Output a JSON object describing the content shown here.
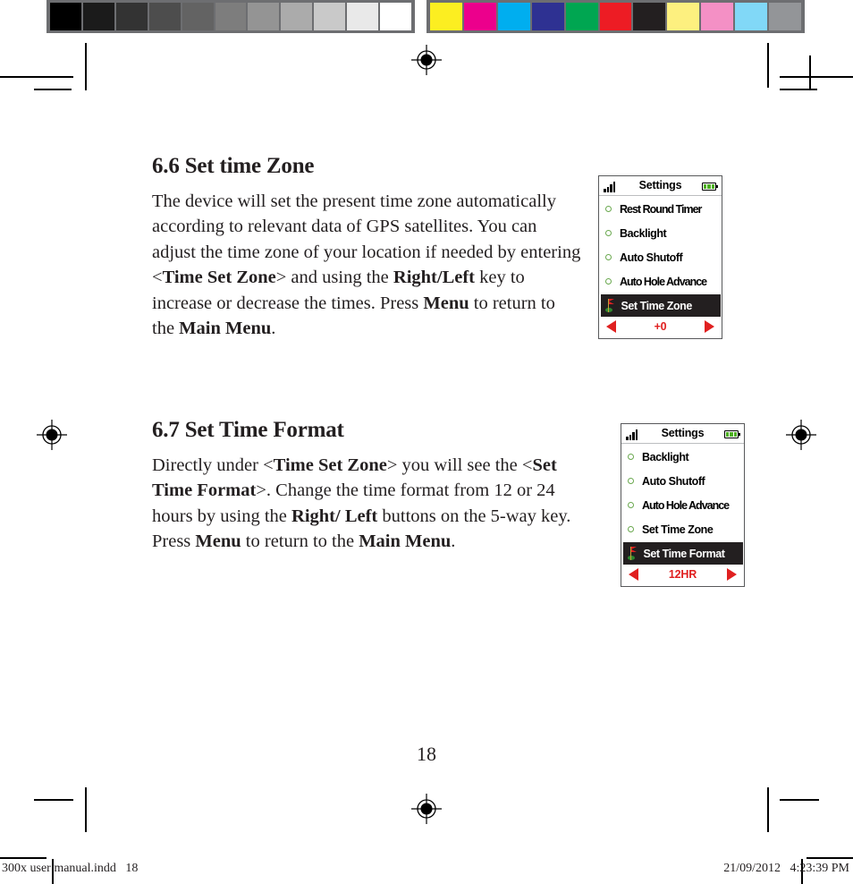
{
  "print_marks": {
    "gray_swatches": [
      "#000000",
      "#1b1b1b",
      "#333333",
      "#4d4d4d",
      "#636363",
      "#7d7d7d",
      "#949494",
      "#ababab",
      "#c9c9c9",
      "#e9e9e9",
      "#ffffff"
    ],
    "color_swatches": [
      "#fcee21",
      "#ec008c",
      "#00aeef",
      "#2e3192",
      "#00a651",
      "#ed1c24",
      "#231f20",
      "#fdf07f",
      "#f490c5",
      "#81d8f7",
      "#939598"
    ],
    "bar_background": "#6d6e71",
    "registration_mark_name": "registration-target"
  },
  "sections": [
    {
      "heading": "6.6 Set time Zone",
      "body_html": "The device will set the present time zone automatically according to relevant data of GPS satellites. You can adjust the time zone of your location if needed by entering &lt;<b>Time Set Zone</b>&gt; and using the <b>Right/Left</b> key to increase or decrease the times. Press <b>Menu</b> to return to the <b>Main Menu</b>."
    },
    {
      "heading": "6.7 Set Time Format",
      "body_html": "Directly under &lt;<b>Time Set Zone</b>&gt; you will see the &lt;<b>Set Time Format</b>&gt;. Change the time format from 12 or 24 hours by using the <b>Right/ Left</b> buttons on the 5-way key. Press <b>Menu</b> to return to the <b>Main Menu</b>."
    }
  ],
  "devices": [
    {
      "title": "Settings",
      "signal_icon": "signal-bars-icon",
      "battery_icon": "battery-full-icon",
      "items": [
        {
          "label": "Rest Round Timer",
          "selected": false,
          "compact": true
        },
        {
          "label": "Backlight",
          "selected": false,
          "compact": false
        },
        {
          "label": "Auto Shutoff",
          "selected": false,
          "compact": false
        },
        {
          "label": "Auto Hole Advance",
          "selected": false,
          "compact": true
        },
        {
          "label": "Set Time Zone",
          "selected": true,
          "compact": false
        }
      ],
      "footer_value": "+0",
      "left_arrow": "arrow-left-icon",
      "right_arrow": "arrow-right-icon"
    },
    {
      "title": "Settings",
      "signal_icon": "signal-bars-icon",
      "battery_icon": "battery-full-icon",
      "items": [
        {
          "label": "Backlight",
          "selected": false,
          "compact": false
        },
        {
          "label": "Auto Shutoff",
          "selected": false,
          "compact": false
        },
        {
          "label": "Auto Hole Advance",
          "selected": false,
          "compact": true
        },
        {
          "label": "Set Time Zone",
          "selected": false,
          "compact": false
        },
        {
          "label": "Set Time Format",
          "selected": true,
          "compact": false
        }
      ],
      "footer_value": "12HR",
      "left_arrow": "arrow-left-icon",
      "right_arrow": "arrow-right-icon"
    }
  ],
  "page_number": "18",
  "footer": {
    "left": "300x user manual.indd   18",
    "right": "21/09/2012   4:23:39 PM"
  }
}
